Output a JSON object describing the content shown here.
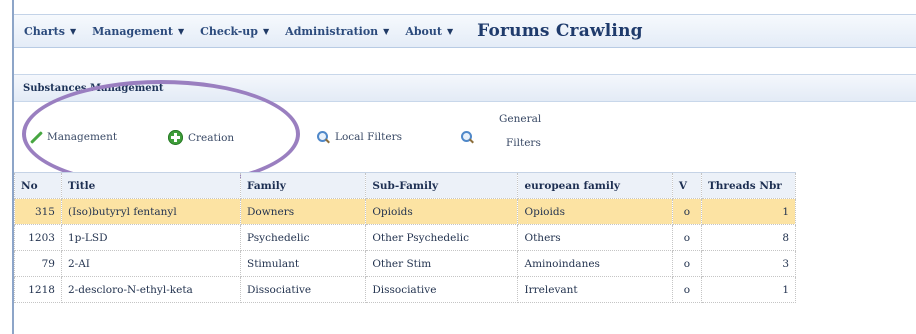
{
  "menu": {
    "items": [
      {
        "label": "Charts",
        "caret": "▼"
      },
      {
        "label": "Management",
        "caret": "▼"
      },
      {
        "label": "Check-up",
        "caret": "▼"
      },
      {
        "label": "Administration",
        "caret": "▼"
      },
      {
        "label": "About",
        "caret": "▼"
      }
    ],
    "title": "Forums Crawling"
  },
  "panel": {
    "title": "Substances Management"
  },
  "toolbar": {
    "management": "Management",
    "creation": "Creation",
    "local_filters": "Local Filters",
    "general_filters_line1": "General",
    "general_filters_line2": "Filters"
  },
  "table": {
    "headers": [
      "No",
      "Title",
      "Family",
      "Sub-Family",
      "european family",
      "V",
      "Threads Nbr"
    ],
    "rows": [
      [
        "315",
        "(Iso)butyryl fentanyl",
        "Downers",
        "Opioids",
        "Opioids",
        "o",
        "1"
      ],
      [
        "1203",
        "1p-LSD",
        "Psychedelic",
        "Other Psychedelic",
        "Others",
        "o",
        "8"
      ],
      [
        "79",
        "2-AI",
        "Stimulant",
        "Other Stim",
        "Aminoindanes",
        "o",
        "3"
      ],
      [
        "1218",
        "2-desclоro-N-ethyl-keta",
        "Dissociative",
        "Dissociative",
        "Irrelevant",
        "o",
        "1"
      ]
    ]
  },
  "colors": {
    "selected_row": "#fce3a3",
    "annotation": "#9a7fc0",
    "menu_text": "#2b4a7c"
  }
}
